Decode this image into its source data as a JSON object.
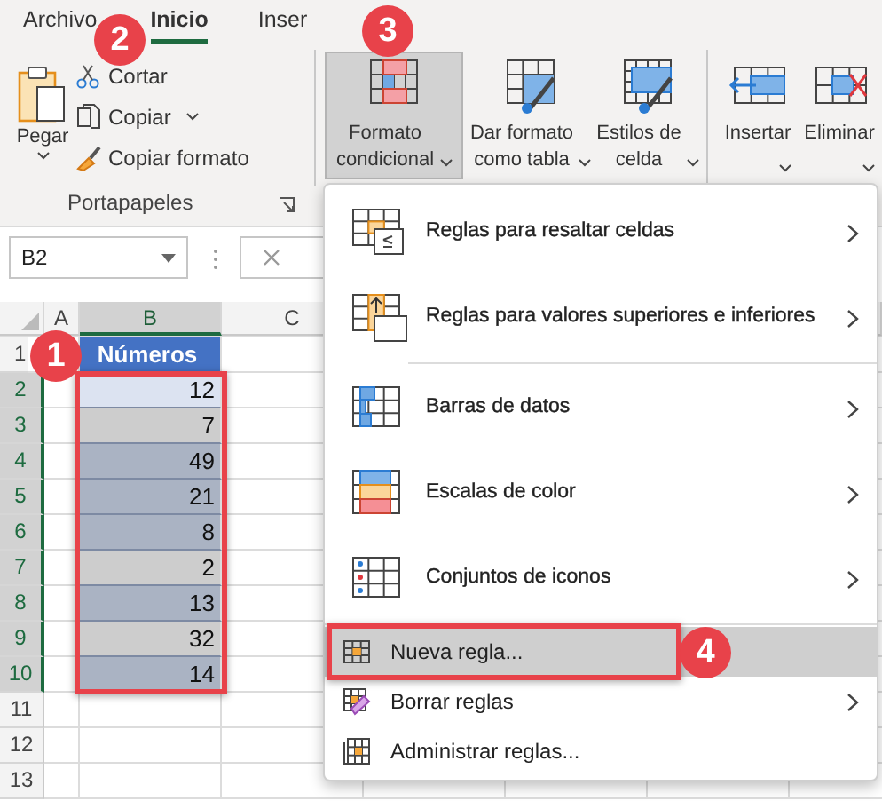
{
  "ribbon_tabs": [
    {
      "label": "Archivo",
      "selected": false
    },
    {
      "label": "Inicio",
      "selected": true
    },
    {
      "label": "Inser",
      "selected": false
    }
  ],
  "ribbon": {
    "clipboard": {
      "title": "Portapapeles",
      "paste": {
        "label": "Pegar",
        "dropdown": true
      },
      "commands": [
        {
          "label": "Cortar",
          "dropdown": false
        },
        {
          "label": "Copiar",
          "dropdown": true
        },
        {
          "label": "Copiar formato",
          "dropdown": false
        }
      ]
    },
    "styles": [
      {
        "lines": [
          "Formato",
          "condicional"
        ],
        "dropdown": true,
        "pressed": true
      },
      {
        "lines": [
          "Dar formato",
          "como tabla"
        ],
        "dropdown": true,
        "pressed": false
      },
      {
        "lines": [
          "Estilos de",
          "celda"
        ],
        "dropdown": true,
        "pressed": false
      }
    ],
    "cells": [
      {
        "lines": [
          "Insertar"
        ],
        "dropdown": true,
        "pressed": false
      },
      {
        "lines": [
          "Eliminar"
        ],
        "dropdown": true,
        "pressed": false
      }
    ]
  },
  "name_box": {
    "value": "B2"
  },
  "sheet": {
    "columns": [
      {
        "label": "A",
        "selected": false
      },
      {
        "label": "B",
        "selected": true
      },
      {
        "label": "C",
        "selected": false
      }
    ],
    "range_framed": true,
    "rows": [
      {
        "number": "1",
        "selected": false,
        "kind": "header",
        "value": "Números"
      },
      {
        "number": "2",
        "selected": true,
        "kind": "value",
        "value": "12",
        "color": "#dce3f1"
      },
      {
        "number": "3",
        "selected": true,
        "kind": "value",
        "value": "7",
        "color": "#cdcdcd"
      },
      {
        "number": "4",
        "selected": true,
        "kind": "value",
        "value": "49",
        "color": "#aab3c3"
      },
      {
        "number": "5",
        "selected": true,
        "kind": "value",
        "value": "21",
        "color": "#aab3c3"
      },
      {
        "number": "6",
        "selected": true,
        "kind": "value",
        "value": "8",
        "color": "#aab3c3"
      },
      {
        "number": "7",
        "selected": true,
        "kind": "value",
        "value": "2",
        "color": "#cdcdcd"
      },
      {
        "number": "8",
        "selected": true,
        "kind": "value",
        "value": "13",
        "color": "#aab3c3"
      },
      {
        "number": "9",
        "selected": true,
        "kind": "value",
        "value": "32",
        "color": "#cdcdcd"
      },
      {
        "number": "10",
        "selected": true,
        "kind": "value",
        "value": "14",
        "color": "#aab3c3"
      },
      {
        "number": "11",
        "selected": false,
        "kind": "empty"
      },
      {
        "number": "12",
        "selected": false,
        "kind": "empty"
      },
      {
        "number": "13",
        "selected": false,
        "kind": "empty"
      }
    ]
  },
  "menu": {
    "items": [
      {
        "kind": "large",
        "label": "Reglas para resaltar celdas",
        "submenu": true,
        "selected": false,
        "framed": false
      },
      {
        "kind": "large",
        "label": "Reglas para valores superiores e inferiores",
        "submenu": true,
        "selected": false,
        "framed": false
      },
      {
        "kind": "separator"
      },
      {
        "kind": "large",
        "label": "Barras de datos",
        "submenu": true,
        "selected": false,
        "framed": false
      },
      {
        "kind": "large",
        "label": "Escalas de color",
        "submenu": true,
        "selected": false,
        "framed": false
      },
      {
        "kind": "large",
        "label": "Conjuntos de iconos",
        "submenu": true,
        "selected": false,
        "framed": false
      },
      {
        "kind": "separator"
      },
      {
        "kind": "small",
        "label": "Nueva regla...",
        "submenu": false,
        "selected": true,
        "framed": true
      },
      {
        "kind": "small",
        "label": "Borrar reglas",
        "submenu": true,
        "selected": false,
        "framed": false
      },
      {
        "kind": "small",
        "label": "Administrar reglas...",
        "submenu": false,
        "selected": false,
        "framed": false
      }
    ]
  },
  "callouts": [
    {
      "number": "1"
    },
    {
      "number": "2"
    },
    {
      "number": "3"
    },
    {
      "number": "4"
    }
  ]
}
